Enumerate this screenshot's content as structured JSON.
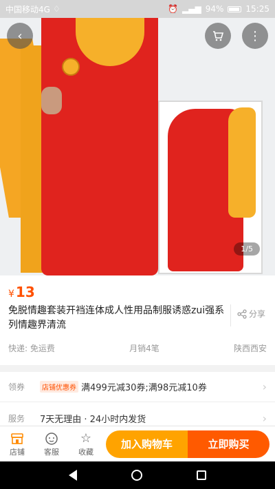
{
  "status_bar": {
    "carrier": "中国移动4G",
    "battery": "94%",
    "time": "15:25"
  },
  "gallery": {
    "pager": "1/5"
  },
  "product": {
    "currency": "¥",
    "price": "13",
    "title": "免脱情趣套装开裆连体成人性用品制服诱惑zui强系列情趣界清流",
    "share_label": "分享",
    "shipping": "快递: 免运费",
    "monthly_sales": "月销4笔",
    "location": "陕西西安"
  },
  "coupon": {
    "label": "领券",
    "tag": "店铺优惠券",
    "text": "满499元减30券;满98元减10券"
  },
  "service": {
    "label": "服务",
    "text": "7天无理由 · 24小时内发货"
  },
  "action_bar": {
    "shop_label": "店铺",
    "service_label": "客服",
    "favorite_label": "收藏",
    "add_to_cart": "加入购物车",
    "buy_now": "立即购买"
  }
}
